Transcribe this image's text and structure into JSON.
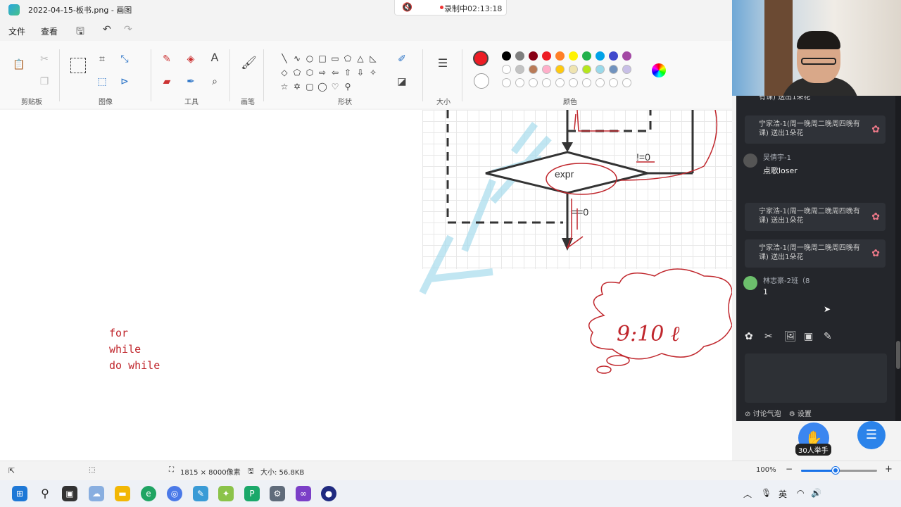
{
  "window": {
    "title": "2022-04-15-板书.png - 画图"
  },
  "recording": {
    "status": "录制中02:13:18"
  },
  "menu": {
    "file": "文件",
    "view": "查看"
  },
  "ribbon": {
    "groups": [
      "剪贴板",
      "图像",
      "工具",
      "画笔",
      "形状",
      "大小",
      "颜色"
    ],
    "shape_glyphs": [
      "╲",
      "∿",
      "○",
      "□",
      "▭",
      "⬠",
      "△",
      "◺",
      "◇",
      "⬠",
      "⬡",
      "⇨",
      "⇦",
      "⇧",
      "⇩",
      "✧",
      "☆",
      "✡",
      "▢",
      "◯",
      "♡",
      "⚲"
    ],
    "colors_row1": [
      "#000000",
      "#7f7f7f",
      "#880015",
      "#ed1c24",
      "#ff7f27",
      "#fff200",
      "#22b14c",
      "#00a2e8",
      "#3f48cc",
      "#a349a4"
    ],
    "colors_row2": [
      "#ffffff",
      "#c3c3c3",
      "#b97a57",
      "#ffaec9",
      "#ffc90e",
      "#efe4b0",
      "#b5e61d",
      "#99d9ea",
      "#7092be",
      "#c8bfe7"
    ],
    "colors_row3": [
      "#ffffff",
      "#ffffff",
      "#ffffff",
      "#ffffff",
      "#ffffff",
      "#ffffff",
      "#ffffff",
      "#ffffff",
      "#ffffff",
      "#ffffff"
    ],
    "color1": "#ed1c24",
    "color2": "#ffffff"
  },
  "canvas": {
    "diagram": {
      "node": "expr",
      "branch_true": "!=0",
      "branch_false": "==0"
    },
    "loops": [
      "for",
      "while",
      "do while"
    ],
    "cloud_scribble": "9:10 ℓ",
    "ink_color": "#c0272d"
  },
  "status": {
    "dimensions": "1815 × 8000像素",
    "size": "大小: 56.8KB",
    "zoom": "100%",
    "zoom_fraction": 0.45
  },
  "chat": {
    "messages": [
      {
        "type": "gift",
        "text": "有课) 送出1朵花"
      },
      {
        "type": "gift",
        "text": "宁家浩-1(周一晚周二晚周四晚有课) 送出1朵花"
      },
      {
        "type": "user",
        "name": "吴倩宇-1",
        "text": "点歌loser"
      },
      {
        "type": "gift",
        "text": "宁家浩-1(周一晚周二晚周四晚有课) 送出1朵花"
      },
      {
        "type": "gift",
        "text": "宁家浩-1(周一晚周二晚周四晚有课) 送出1朵花"
      },
      {
        "type": "user",
        "name": "林志豪-2班（8",
        "text": "1"
      }
    ],
    "footer_bubble": "讨论气泡",
    "footer_settings": "设置",
    "raise_count": "30人举手"
  },
  "taskbar": {
    "ime": "英"
  }
}
